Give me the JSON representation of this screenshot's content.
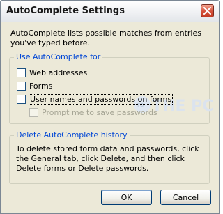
{
  "window": {
    "title": "AutoComplete Settings"
  },
  "intro_text": "AutoComplete lists possible matches from entries you've typed before.",
  "use_group": {
    "legend": "Use AutoComplete for",
    "items": [
      {
        "label": "Web addresses",
        "checked": false,
        "enabled": true,
        "focused": false
      },
      {
        "label": "Forms",
        "checked": false,
        "enabled": true,
        "focused": false
      },
      {
        "label": "User names and passwords on forms",
        "checked": false,
        "enabled": true,
        "focused": true
      },
      {
        "label": "Prompt me to save passwords",
        "checked": false,
        "enabled": false,
        "focused": false
      }
    ]
  },
  "watermark": {
    "text": "TO THE PC"
  },
  "delete_group": {
    "legend": "Delete AutoComplete history",
    "text": "To delete stored form data and passwords, click the General tab, click Delete, and then click Delete forms or Delete passwords."
  },
  "buttons": {
    "ok": "OK",
    "cancel": "Cancel"
  },
  "colors": {
    "dialog_bg": "#ece9d8",
    "legend_text": "#0046d5",
    "close_button": "#d4503a",
    "button_border": "#003c74"
  },
  "icons": {
    "close": "close-icon"
  }
}
